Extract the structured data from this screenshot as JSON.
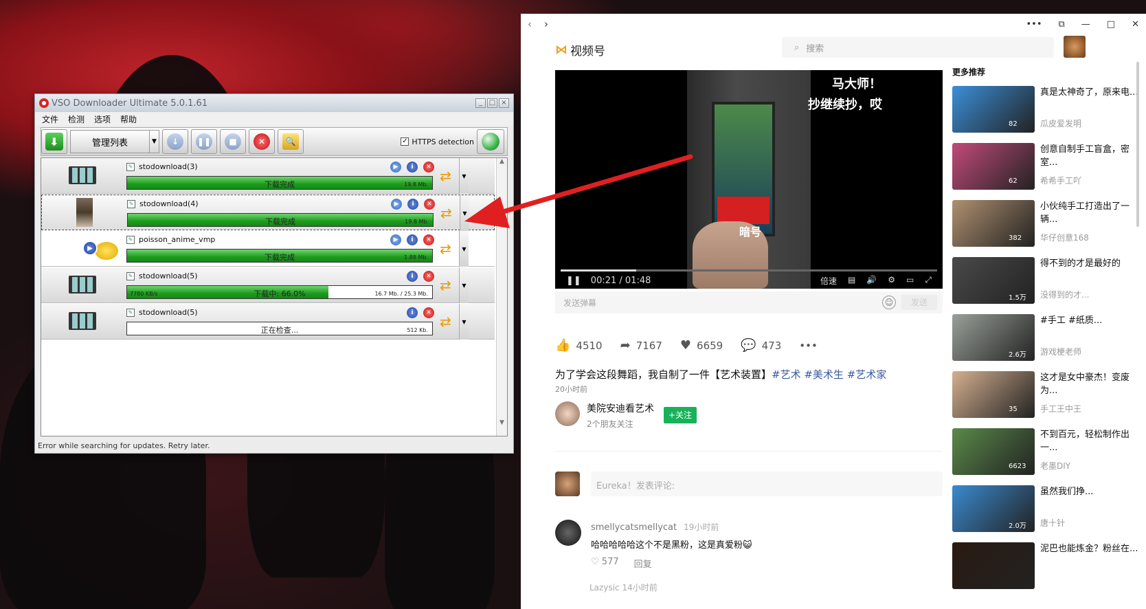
{
  "vso": {
    "title": "VSO Downloader Ultimate 5.0.1.61",
    "menu": [
      "文件",
      "检测",
      "选项",
      "帮助"
    ],
    "combo": "管理列表",
    "https_label": "HTTPS detection",
    "rows": [
      {
        "name": "stodownload(3)",
        "status": "下载完成",
        "right": "19.8 Mb.",
        "left": "",
        "progress": 1.0
      },
      {
        "name": "stodownload(4)",
        "status": "下载完成",
        "right": "19.8 Mb.",
        "left": "",
        "progress": 1.0
      },
      {
        "name": "poisson_anime_vmp",
        "status": "下载完成",
        "right": "1.88 Mb.",
        "left": "",
        "progress": 1.0
      },
      {
        "name": "stodownload(5)",
        "status": "下载中: 66.0%",
        "right": "16.7 Mb. / 25.3 Mb.",
        "left": "7780 KB/s",
        "progress": 0.66
      },
      {
        "name": "stodownload(5)",
        "status": "正在检查...",
        "right": "512 Kb.",
        "left": "",
        "progress": 0
      }
    ],
    "status": "Error while searching for updates. Retry later."
  },
  "browser": {
    "brand": "视频号",
    "search_placeholder": "搜索",
    "video": {
      "caption1": "马大师！",
      "caption2": "抄继续抄，哎",
      "label": "暗号",
      "time": "00:21 / 01:48",
      "speed": "倍速",
      "progress": 0.2
    },
    "danmu_placeholder": "发送弹幕",
    "danmu_send": "发送",
    "stats": {
      "likes": "4510",
      "shares": "7167",
      "hearts": "6659",
      "comments": "473"
    },
    "desc_text": "为了学会这段舞蹈，我自制了一件【艺术装置】",
    "desc_tags": "#艺术 #美术生 #艺术家",
    "time": "20小时前",
    "author": {
      "name": "美院安迪看艺术",
      "sub": "2个朋友关注",
      "follow": "+关注"
    },
    "comment_placeholder": "Eureka！发表评论:",
    "comment": {
      "user": "smellycatsmellycat",
      "time": "19小时前",
      "text": "哈哈哈哈哈这个不是黑粉，这是真爱粉😺",
      "likes": "577",
      "reply": "回复"
    },
    "comment2": "Lazysic  14小时前",
    "side_title": "更多推荐",
    "cards": [
      {
        "title": "真是太神奇了，原来电...",
        "author": "瓜皮爱发明",
        "likes": "82",
        "color": "#3b8fd9"
      },
      {
        "title": "创意自制手工盲盒，密室...",
        "author": "希希手工吖",
        "likes": "62",
        "color": "#c24a7a"
      },
      {
        "title": "小伙纯手工打造出了一辆...",
        "author": "华仔创意168",
        "likes": "382",
        "color": "#b09070"
      },
      {
        "title": "得不到的才是最好的",
        "author": "没得到的才...",
        "likes": "1.5万",
        "color": "#4a4a4a"
      },
      {
        "title": "#手工 #纸质...",
        "author": "游戏梗老师",
        "likes": "2.6万",
        "color": "#9aa09a"
      },
      {
        "title": "这才是女中豪杰！变废为...",
        "author": "手工王中王",
        "likes": "35",
        "color": "#d4b090"
      },
      {
        "title": "不到百元，轻松制作出一...",
        "author": "老墨DIY",
        "likes": "6623",
        "color": "#5a8a4a"
      },
      {
        "title": "虽然我们挣...",
        "author": "唐十针",
        "likes": "2.0万",
        "color": "#3a8ad0"
      },
      {
        "title": "泥巴也能炼金？粉丝在...",
        "author": "",
        "likes": "",
        "color": "#2a1a12"
      }
    ]
  }
}
